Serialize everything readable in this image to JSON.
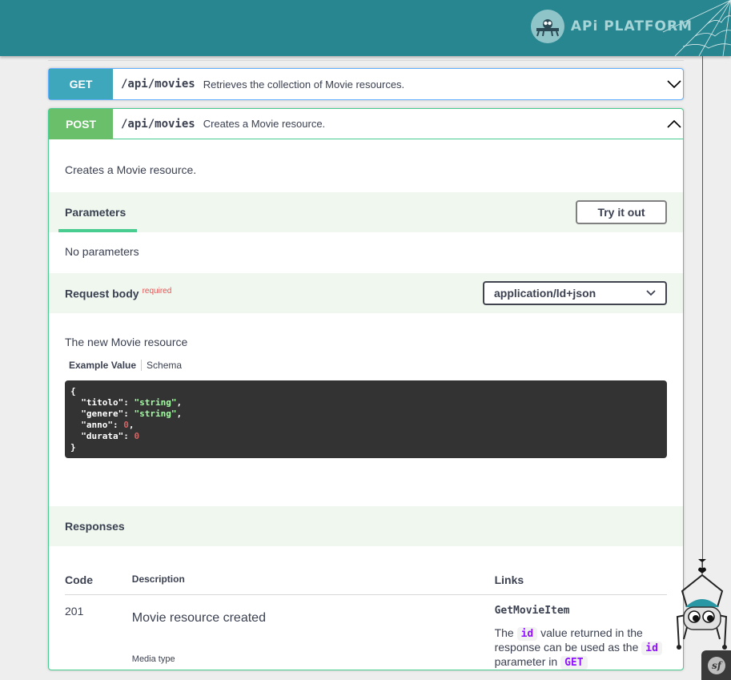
{
  "header": {
    "brand_text": "APi PLATFORM",
    "bg_color": "#288690",
    "brand_color": "#a7d4d6"
  },
  "operations": [
    {
      "method": "GET",
      "path": "/api/movies",
      "summary": "Retrieves the collection of Movie resources.",
      "color": "#3ea7bc"
    },
    {
      "method": "POST",
      "path": "/api/movies",
      "summary": "Creates a Movie resource.",
      "color": "#6abf6a"
    }
  ],
  "post_detail": {
    "description": "Creates a Movie resource.",
    "parameters": {
      "title": "Parameters",
      "try_button": "Try it out",
      "empty_text": "No parameters"
    },
    "request_body": {
      "title": "Request body",
      "required_label": "required",
      "content_type": "application/ld+json",
      "description": "The new Movie resource",
      "tab_example": "Example Value",
      "tab_schema": "Schema",
      "example": {
        "open": "{",
        "fields": [
          {
            "key": "\"titolo\"",
            "value": "\"string\"",
            "kind": "string",
            "comma": ","
          },
          {
            "key": "\"genere\"",
            "value": "\"string\"",
            "kind": "string",
            "comma": ","
          },
          {
            "key": "\"anno\"",
            "value": "0",
            "kind": "number",
            "comma": ","
          },
          {
            "key": "\"durata\"",
            "value": "0",
            "kind": "number",
            "comma": ""
          }
        ],
        "close": "}"
      }
    },
    "responses": {
      "title": "Responses",
      "headers": {
        "code": "Code",
        "description": "Description",
        "links": "Links"
      },
      "rows": [
        {
          "code": "201",
          "description": "Movie resource created",
          "media_type_label": "Media type",
          "link_name": "GetMovieItem",
          "link_text_1": "The",
          "link_chip_1": "id",
          "link_text_2": "value returned in the response can be used as the",
          "link_chip_2": "id",
          "link_text_3": "parameter in",
          "link_chip_3": "GET"
        }
      ]
    }
  }
}
